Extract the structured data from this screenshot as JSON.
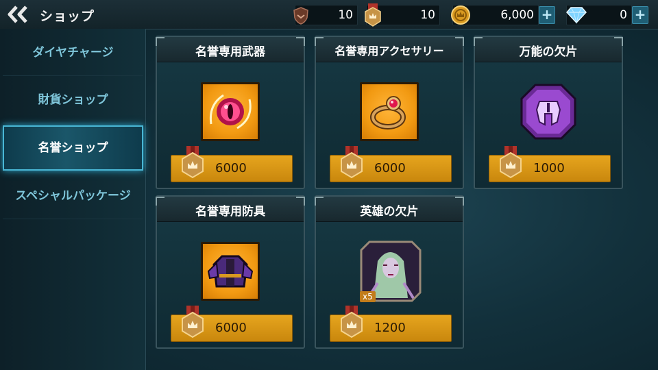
{
  "header": {
    "title": "ショップ",
    "currencies": [
      {
        "name": "shield-token-icon",
        "value": "10"
      },
      {
        "name": "honor-medal-icon",
        "value": "10"
      },
      {
        "name": "gold-coin-icon",
        "value": "6,000"
      },
      {
        "name": "diamond-icon",
        "value": "0"
      }
    ],
    "plus_label": "+"
  },
  "sidebar": {
    "items": [
      {
        "label": "ダイヤチャージ",
        "active": false
      },
      {
        "label": "財貨ショップ",
        "active": false
      },
      {
        "label": "名誉ショップ",
        "active": true
      },
      {
        "label": "スペシャルパッケージ",
        "active": false
      }
    ]
  },
  "shop": {
    "items": [
      {
        "title": "名誉専用武器",
        "price": "6000",
        "icon": "crimson-eye-orb-icon"
      },
      {
        "title": "名誉専用アクセサリー",
        "price": "6000",
        "icon": "ruby-ring-icon"
      },
      {
        "title": "万能の欠片",
        "price": "1000",
        "icon": "purple-helmet-shard-icon"
      },
      {
        "title": "名誉専用防具",
        "price": "6000",
        "icon": "purple-armor-icon"
      },
      {
        "title": "英雄の欠片",
        "price": "1200",
        "icon": "hero-portrait-icon",
        "quantity": "x5"
      }
    ]
  },
  "colors": {
    "accent": "#49b6d4",
    "price_bar": "#e6a51e",
    "item_bg": "#f29a12",
    "medal": "#b0332a"
  }
}
